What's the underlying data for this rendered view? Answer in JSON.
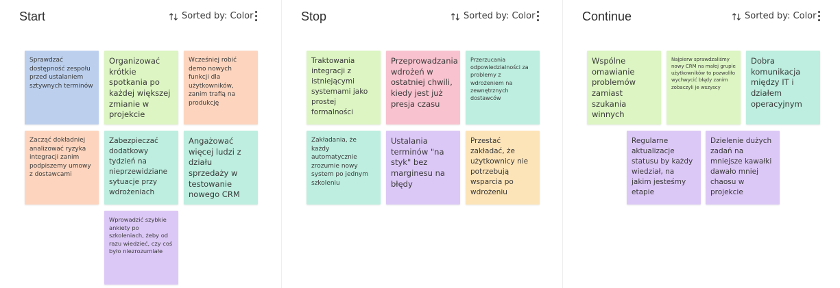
{
  "sort_label": "Sorted by: Color",
  "colors": {
    "blue": "#bcd0ee",
    "green": "#dcf5c2",
    "orange": "#fdd5be",
    "teal": "#bdeedf",
    "purple": "#dcc8f6",
    "pink": "#f8c3cf",
    "yellow": "#fde4b8"
  },
  "columns": [
    {
      "title": "Start",
      "notes": [
        {
          "color": "blue",
          "text": "Sprawdzać dostępność zespołu przed ustalaniem sztywnych terminów"
        },
        {
          "color": "green",
          "text": "Organizować krótkie spotkania po każdej większej zmianie w projekcie"
        },
        {
          "color": "orange",
          "text": "Wcześniej robić demo nowych funkcji dla użytkowników, zanim trafią na produkcję"
        },
        {
          "color": "orange",
          "text": "Zacząć dokładniej analizować ryzyka integracji zanim podpiszemy umowy z dostawcami"
        },
        {
          "color": "teal",
          "text": "Zabezpieczać dodatkowy tydzień na nieprzewidziane sytuacje przy wdrożeniach"
        },
        {
          "color": "teal",
          "text": "Angażować więcej ludzi z działu sprzedaży w testowanie nowego CRM"
        },
        {
          "color": "purple",
          "text": "Wprowadzić szybkie ankiety po szkoleniach, żeby od razu wiedzieć, czy coś było niezrozumiałe"
        }
      ]
    },
    {
      "title": "Stop",
      "notes": [
        {
          "color": "green",
          "text": "Traktowania integracji z istniejącymi systemami jako prostej formalności"
        },
        {
          "color": "pink",
          "text": "Przeprowadzania wdrożeń w ostatniej chwili, kiedy jest już presja czasu"
        },
        {
          "color": "teal",
          "text": "Przerzucania odpowiedzialności za problemy z wdrożeniem na zewnętrznych dostawców"
        },
        {
          "color": "teal",
          "text": "Zakładania, że każdy automatycznie zrozumie nowy system po jednym szkoleniu"
        },
        {
          "color": "purple",
          "text": "Ustalania terminów \"na styk\" bez marginesu na błędy"
        },
        {
          "color": "yellow",
          "text": "Przestać zakładać, że użytkownicy nie potrzebują wsparcia po wdrożeniu"
        }
      ]
    },
    {
      "title": "Continue",
      "notes": [
        {
          "color": "green",
          "text": "Wspólne omawianie problemów zamiast szukania winnych"
        },
        {
          "color": "green",
          "text": "Najpierw sprawdzaliśmy nowy CRM na małej grupie użytkowników to pozwoliło wychwycić błędy zanim zobaczyli je wszyscy"
        },
        {
          "color": "teal",
          "text": "Dobra komunikacja między IT i działem operacyjnym"
        },
        {
          "color": "purple",
          "text": "Regularne aktualizacje statusu by każdy wiedział, na jakim jesteśmy etapie"
        },
        {
          "color": "purple",
          "text": "Dzielenie dużych zadań na mniejsze kawałki dawało mniej chaosu w projekcie"
        }
      ]
    }
  ]
}
